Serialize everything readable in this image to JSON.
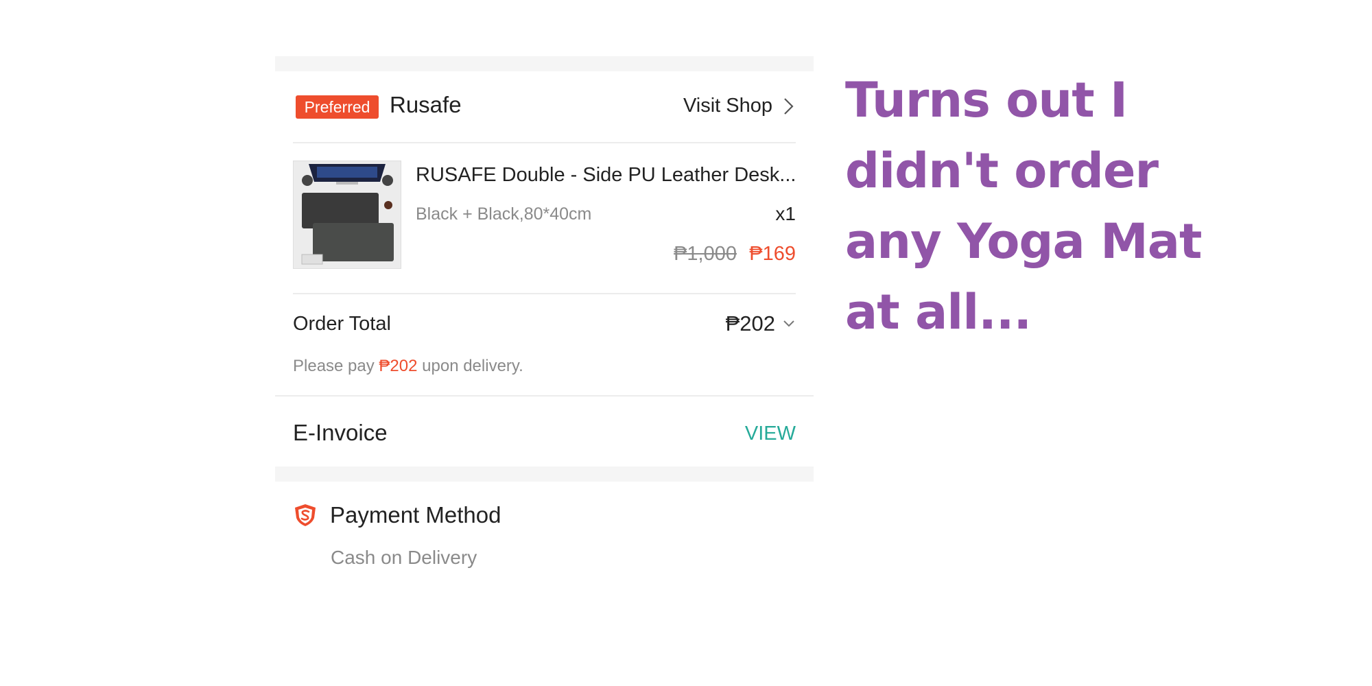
{
  "shop": {
    "badge": "Preferred",
    "name": "Rusafe",
    "visit_label": "Visit Shop"
  },
  "product": {
    "title": "RUSAFE Double - Side PU Leather Desk...",
    "variation": "Black + Black,80*40cm",
    "quantity": "x1",
    "original_price": "₱1,000",
    "sale_price": "₱169"
  },
  "order_total": {
    "label": "Order Total",
    "value": "₱202",
    "note_prefix": "Please pay ",
    "note_amount": "₱202",
    "note_suffix": " upon delivery."
  },
  "einvoice": {
    "label": "E-Invoice",
    "action": "VIEW"
  },
  "payment": {
    "label": "Payment Method",
    "value": "Cash on Delivery"
  },
  "caption": {
    "lines": [
      "Turns out I",
      "didn't order",
      "any Yoga Mat",
      "at all..."
    ]
  },
  "colors": {
    "accent": "#ee4d2d",
    "link": "#26aa99",
    "caption": "#9155a8"
  },
  "icons": {
    "shop_chevron": "chevron-right-icon",
    "total_chevron": "chevron-down-icon",
    "payment": "shield-icon"
  }
}
